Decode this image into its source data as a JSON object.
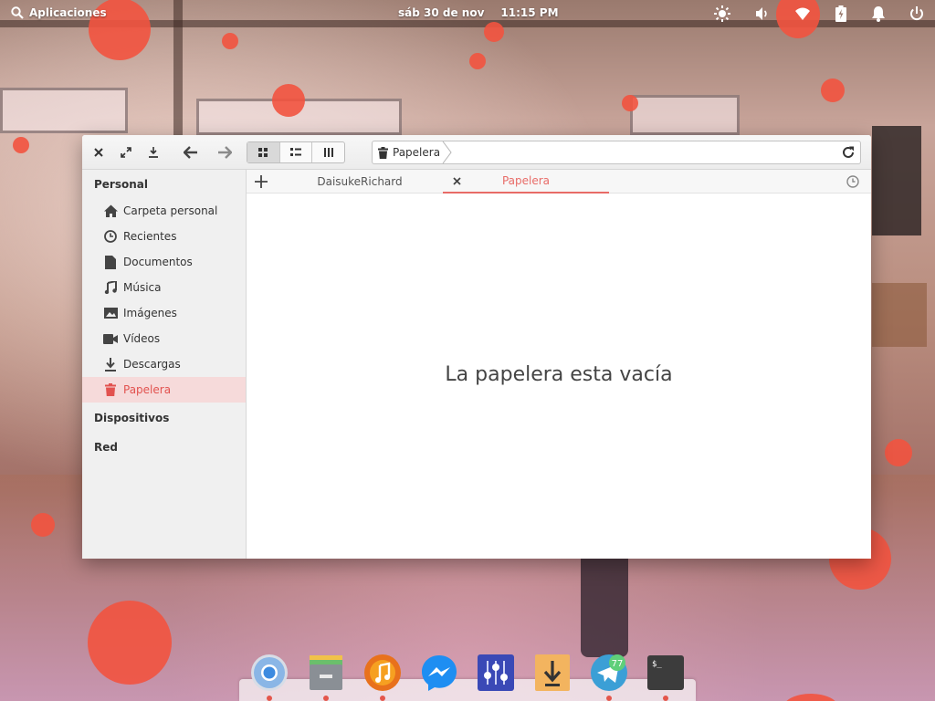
{
  "panel": {
    "applications_label": "Aplicaciones",
    "date": "sáb 30 de nov",
    "time": "11:15 PM"
  },
  "window": {
    "path": {
      "location": "Papelera"
    },
    "sidebar": {
      "sections": {
        "personal": "Personal",
        "devices": "Dispositivos",
        "network": "Red"
      },
      "items": [
        {
          "label": "Carpeta personal",
          "icon": "home-icon"
        },
        {
          "label": "Recientes",
          "icon": "clock-icon"
        },
        {
          "label": "Documentos",
          "icon": "document-icon"
        },
        {
          "label": "Música",
          "icon": "music-icon"
        },
        {
          "label": "Imágenes",
          "icon": "image-icon"
        },
        {
          "label": "Vídeos",
          "icon": "video-icon"
        },
        {
          "label": "Descargas",
          "icon": "download-icon"
        },
        {
          "label": "Papelera",
          "icon": "trash-icon"
        }
      ],
      "selected": "Papelera"
    },
    "tabs": [
      {
        "label": "DaisukeRichard",
        "active": false
      },
      {
        "label": "Papelera",
        "active": true
      }
    ],
    "content": {
      "empty_message": "La papelera esta vacía"
    }
  },
  "dock": {
    "apps": [
      {
        "name": "chromium-icon"
      },
      {
        "name": "files-icon"
      },
      {
        "name": "music-player-icon"
      },
      {
        "name": "messenger-icon"
      },
      {
        "name": "mixer-icon"
      },
      {
        "name": "downloader-icon"
      },
      {
        "name": "telegram-icon",
        "badge": "77"
      },
      {
        "name": "terminal-icon",
        "glyph": "$_"
      }
    ]
  },
  "colors": {
    "accent": "#e86b67",
    "selected_bg": "#f6dada",
    "bokeh": "#f2533f"
  }
}
